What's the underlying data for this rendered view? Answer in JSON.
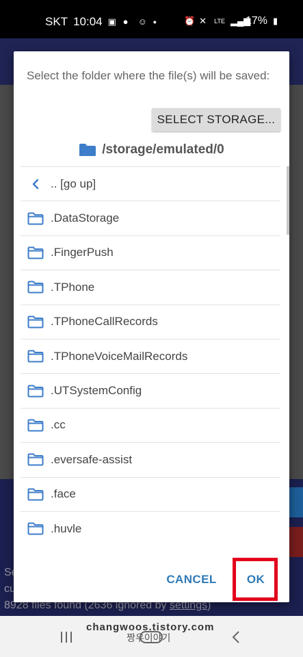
{
  "status_bar": {
    "carrier": "SKT",
    "time": "10:04",
    "signal": "LTE",
    "battery": "17%"
  },
  "background": {
    "line1": "Se",
    "line2": "cu",
    "files_text": "8928 files found (2636 ignored by ",
    "settings_link": "settings",
    "files_suffix": ")"
  },
  "dialog": {
    "message": "Select the folder where the file(s) will be saved:",
    "select_storage_label": "SELECT STORAGE...",
    "current_path": "/storage/emulated/0",
    "go_up_label": ".. [go up]",
    "folders": [
      ".DataStorage",
      ".FingerPush",
      ".TPhone",
      ".TPhoneCallRecords",
      ".TPhoneVoiceMailRecords",
      ".UTSystemConfig",
      ".cc",
      ".eversafe-assist",
      ".face",
      ".huvle"
    ],
    "cancel_label": "CANCEL",
    "ok_label": "OK"
  },
  "colors": {
    "accent": "#2f79b6",
    "folder_icon": "#3d7dc9",
    "highlight": "#e3001b"
  },
  "watermark": {
    "site": "changwoos.tistory.com",
    "author": "짱우이야기"
  }
}
